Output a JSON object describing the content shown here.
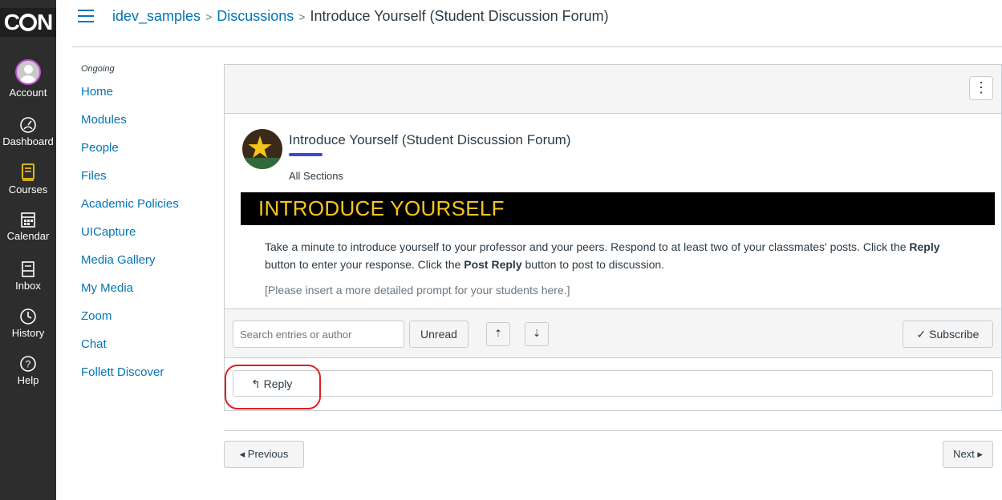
{
  "brand": {
    "logo_text_a": "C",
    "logo_text_b": "N"
  },
  "global_nav": [
    {
      "label": "Account",
      "icon": "account-avatar-icon"
    },
    {
      "label": "Dashboard",
      "icon": "dashboard-gauge-icon"
    },
    {
      "label": "Courses",
      "icon": "courses-book-icon"
    },
    {
      "label": "Calendar",
      "icon": "calendar-icon"
    },
    {
      "label": "Inbox",
      "icon": "inbox-icon"
    },
    {
      "label": "History",
      "icon": "clock-icon"
    },
    {
      "label": "Help",
      "icon": "help-icon"
    }
  ],
  "breadcrumb": {
    "course": "idev_samples",
    "section": "Discussions",
    "current": "Introduce Yourself (Student Discussion Forum)",
    "separator": ">"
  },
  "course_nav": {
    "term": "Ongoing",
    "items": [
      "Home",
      "Modules",
      "People",
      "Files",
      "Academic Policies",
      "UICapture",
      "Media Gallery",
      "My Media",
      "Zoom",
      "Chat",
      "Follett Discover"
    ]
  },
  "options_button": {
    "label": "⋮"
  },
  "post": {
    "title": "Introduce Yourself (Student Discussion Forum)",
    "sections": "All Sections",
    "banner": "INTRODUCE YOURSELF",
    "message_part1": "Take a minute to introduce yourself to your professor and your peers. Respond to at least two of your classmates' posts. Click the ",
    "reply_bold": "Reply",
    "message_part2": " button to enter your response.  Click the ",
    "post_reply_bold": "Post Reply",
    "message_part3": " button to post to discussion.",
    "prompt": "[Please insert a more detailed prompt for your students here.]"
  },
  "toolbar": {
    "search_placeholder": "Search entries or author",
    "unread_label": "Unread",
    "collapse_icon": "⇡",
    "expand_icon": "⇣",
    "subscribe_check": "✓",
    "subscribe_label": "Subscribe"
  },
  "reply": {
    "arrow": "↰",
    "label": "Reply"
  },
  "pager": {
    "previous": "◂ Previous",
    "next": "Next ▸"
  },
  "colors": {
    "link": "#0374b5",
    "nav_bg": "#2d2d2d",
    "banner_bg": "#000000",
    "banner_text": "#f7c51f",
    "highlight": "#e02020"
  }
}
